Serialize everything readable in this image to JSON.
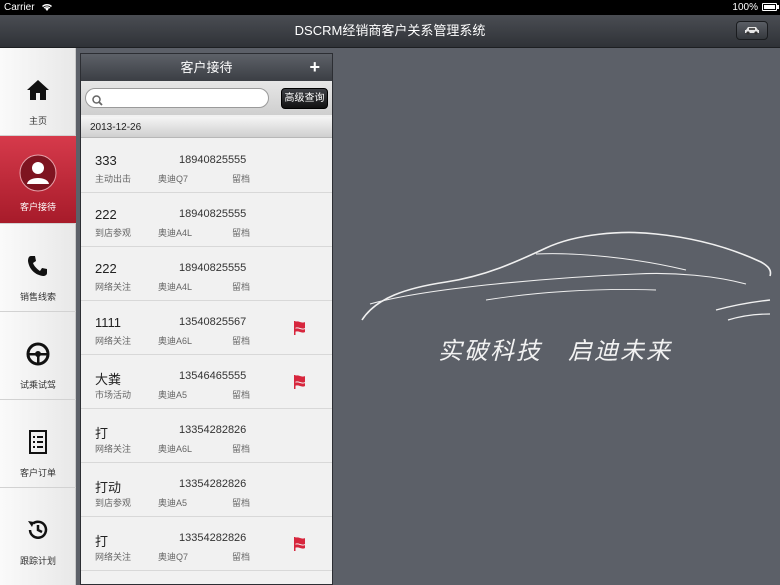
{
  "status_bar": {
    "carrier": "Carrier",
    "time": "",
    "battery": "100%"
  },
  "app": {
    "title": "DSCRM经销商客户关系管理系统"
  },
  "sidebar": {
    "items": [
      {
        "label": "主页",
        "icon": "home-icon"
      },
      {
        "label": "客户接待",
        "icon": "person-icon",
        "active": true
      },
      {
        "label": "销售线索",
        "icon": "phone-icon"
      },
      {
        "label": "试乘试驾",
        "icon": "steering-wheel-icon"
      },
      {
        "label": "客户订单",
        "icon": "document-icon"
      },
      {
        "label": "跟踪计划",
        "icon": "clock-icon"
      }
    ]
  },
  "panel": {
    "title": "客户接待",
    "add_label": "+",
    "search_placeholder": "",
    "search_value": "",
    "advanced_search": "高级查询",
    "date": "2013-12-26",
    "rows": [
      {
        "name": "333",
        "phone": "18940825555",
        "source": "主动出击",
        "car": "奥迪Q7",
        "status": "留档",
        "flag": false
      },
      {
        "name": "222",
        "phone": "18940825555",
        "source": "到店参观",
        "car": "奥迪A4L",
        "status": "留档",
        "flag": false
      },
      {
        "name": "222",
        "phone": "18940825555",
        "source": "网络关注",
        "car": "奥迪A4L",
        "status": "留档",
        "flag": false
      },
      {
        "name": "1111",
        "phone": "13540825567",
        "source": "网络关注",
        "car": "奥迪A6L",
        "status": "留档",
        "flag": true
      },
      {
        "name": "大粪",
        "phone": "13546465555",
        "source": "市场活动",
        "car": "奥迪A5",
        "status": "留档",
        "flag": true
      },
      {
        "name": "打",
        "phone": "13354282826",
        "source": "网络关注",
        "car": "奥迪A6L",
        "status": "留档",
        "flag": false
      },
      {
        "name": "打动",
        "phone": "13354282826",
        "source": "到店参观",
        "car": "奥迪A5",
        "status": "留档",
        "flag": false
      },
      {
        "name": "打",
        "phone": "13354282826",
        "source": "网络关注",
        "car": "奥迪Q7",
        "status": "留档",
        "flag": true
      }
    ]
  },
  "brand": {
    "slogan": "实破科技　启迪未来"
  },
  "colors": {
    "accent": "#c62a3b",
    "flag": "#d7263d",
    "background": "#5c6068"
  }
}
